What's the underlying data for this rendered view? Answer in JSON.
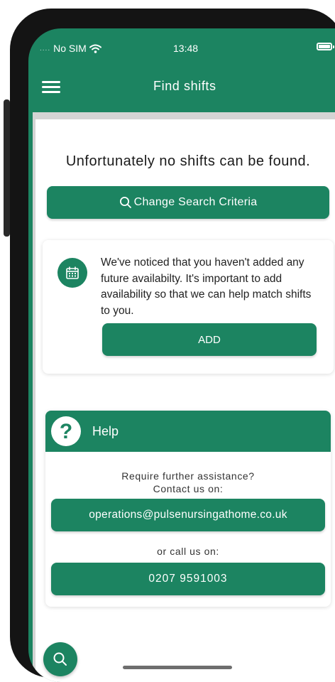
{
  "status_bar": {
    "carrier": "No SIM",
    "time": "13:48"
  },
  "navbar": {
    "title": "Find shifts",
    "menu_icon": "hamburger-menu-icon"
  },
  "results": {
    "empty_message": "Unfortunately no shifts can be found.",
    "change_search_label": "Change Search Criteria",
    "search_icon": "search-icon"
  },
  "availability_card": {
    "icon": "calendar-icon",
    "message": "We've noticed that you haven't added any future availabilty. It's important to add availability so that we can help match shifts to you.",
    "add_label": "ADD"
  },
  "help": {
    "icon": "question-mark-icon",
    "title": "Help",
    "line1": "Require further assistance?",
    "line2": "Contact us on:",
    "email": "operations@pulsenursingathome.co.uk",
    "call_label": "or call us on:",
    "phone": "0207 9591003"
  },
  "fab": {
    "icon": "search-icon"
  },
  "colors": {
    "primary": "#1c8461",
    "background_strip": "#d4d4d4",
    "text": "#1a1a1a"
  }
}
